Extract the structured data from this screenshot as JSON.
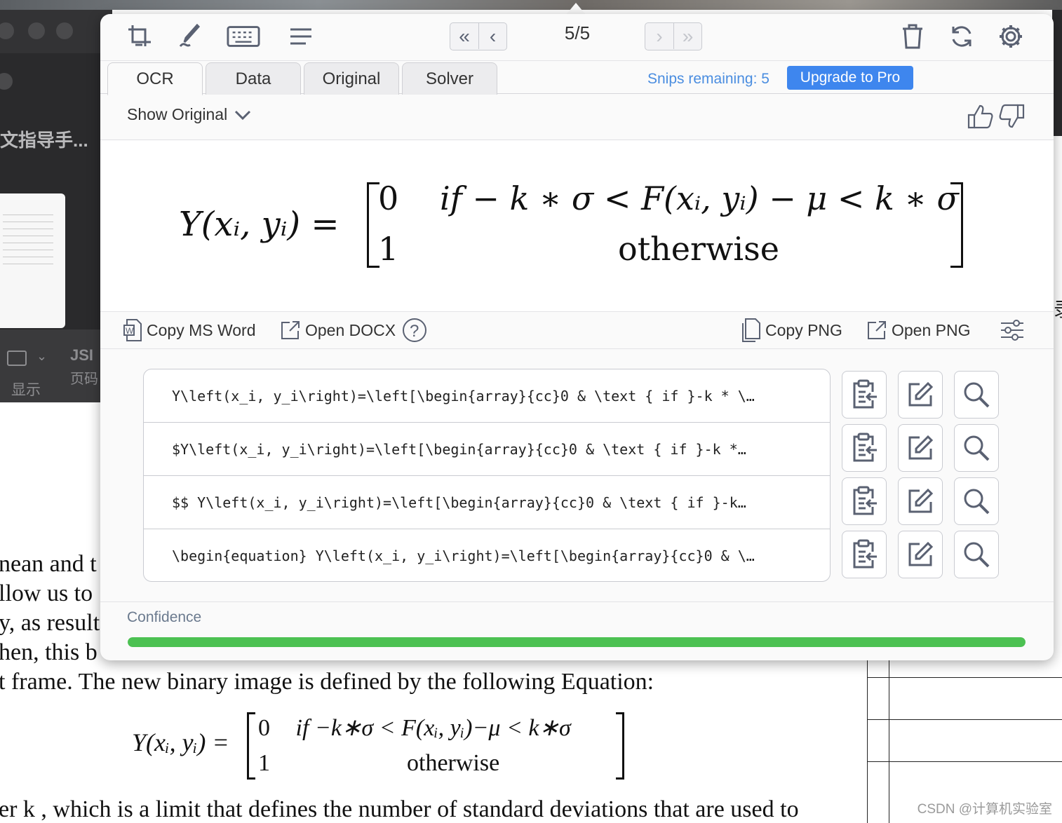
{
  "background": {
    "sidebar_title": "文指导手...",
    "bottom_bar": {
      "label_display": "显示",
      "label_jsi": "JSI",
      "label_page": "页码"
    },
    "document_lines": [
      "nean  and  t",
      "llow us to",
      "y, as result",
      "hen, this b",
      "t frame. The new binary image is defined by the following Equation:",
      "er   k , which is a limit that defines the number of standard deviations that are used to"
    ],
    "document_equation": {
      "lhs": "Y(xᵢ, yᵢ) =",
      "row1_value": "0",
      "row1_condition": "if −k∗σ < F(xᵢ, yᵢ)−μ < k∗σ",
      "row2_value": "1",
      "row2_condition": "otherwise"
    },
    "cjk_fragment": "录",
    "watermark": "CSDN @计算机实验室"
  },
  "panel": {
    "toolbar": {
      "icons": [
        "snip-crop-icon",
        "handwriting-pen-icon",
        "keyboard-icon",
        "text-lines-icon",
        "trash-icon",
        "refresh-icon",
        "settings-gear-icon"
      ],
      "first_label": "«",
      "prev_label": "‹",
      "next_label": "›",
      "last_label": "»",
      "page_counter": "5/5"
    },
    "tabs": [
      "OCR",
      "Data",
      "Original",
      "Solver"
    ],
    "active_tab": "OCR",
    "snips_remaining": "Snips remaining: 5",
    "upgrade_label": "Upgrade to Pro",
    "show_original": "Show Original",
    "rendered_equation": {
      "lhs": "Y(xᵢ, yᵢ) =",
      "row1_value": "0",
      "row1_condition": "if  − k ∗ σ < F(xᵢ, yᵢ) − μ < k ∗ σ",
      "row2_value": "1",
      "row2_condition": "otherwise"
    },
    "actions": {
      "copy_ms_word": "Copy MS Word",
      "open_docx": "Open DOCX",
      "help": "?",
      "copy_png": "Copy PNG",
      "open_png": "Open PNG"
    },
    "formats": [
      "Y\\left(x_i, y_i\\right)=\\left[\\begin{array}{cc}0 & \\text { if }-k * \\…",
      "$Y\\left(x_i, y_i\\right)=\\left[\\begin{array}{cc}0 & \\text { if }-k *…",
      "$$ Y\\left(x_i, y_i\\right)=\\left[\\begin{array}{cc}0 & \\text { if }-k…",
      "\\begin{equation} Y\\left(x_i, y_i\\right)=\\left[\\begin{array}{cc}0 & \\…"
    ],
    "row_button_icons": [
      "copy-clipboard-icon",
      "edit-icon",
      "search-icon"
    ],
    "confidence": {
      "label": "Confidence",
      "value": 1.0
    },
    "colors": {
      "accent": "#3e86ee",
      "snips_text": "#4a8de0",
      "confidence_bar": "#4cc152",
      "icon": "#5a6172"
    }
  }
}
